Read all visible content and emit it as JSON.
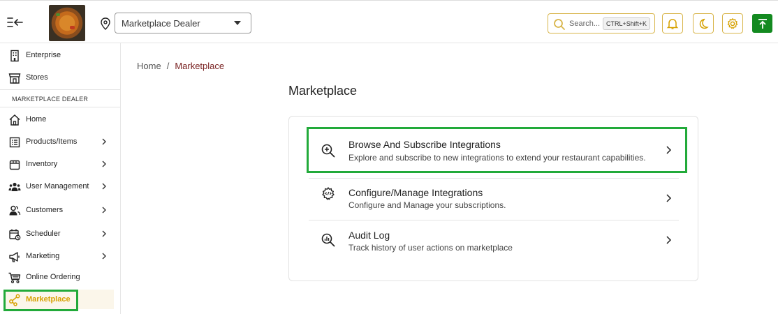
{
  "header": {
    "store_select": {
      "value": "Marketplace Dealer"
    },
    "search": {
      "placeholder": "Search...",
      "shortcut": "CTRL+Shift+K"
    },
    "icons": [
      "bell-icon",
      "moon-icon",
      "gear-icon",
      "arrow-up-icon"
    ],
    "accent_color": "#d8b54a",
    "primary_color": "#138a20"
  },
  "sidebar": {
    "top_items": [
      {
        "label": "Enterprise",
        "icon": "building-icon"
      },
      {
        "label": "Stores",
        "icon": "store-icon"
      }
    ],
    "section_label": "MARKETPLACE DEALER",
    "items": [
      {
        "label": "Home",
        "icon": "home-icon",
        "has_submenu": false
      },
      {
        "label": "Products/Items",
        "icon": "list-icon",
        "has_submenu": true
      },
      {
        "label": "Inventory",
        "icon": "box-icon",
        "has_submenu": true
      },
      {
        "label": "User Management",
        "icon": "users-icon",
        "has_submenu": true
      },
      {
        "label": "Customers",
        "icon": "customers-icon",
        "has_submenu": true
      },
      {
        "label": "Scheduler",
        "icon": "calendar-icon",
        "has_submenu": true
      },
      {
        "label": "Marketing",
        "icon": "megaphone-icon",
        "has_submenu": true
      },
      {
        "label": "Online Ordering",
        "icon": "cart-icon",
        "has_submenu": false
      },
      {
        "label": "Marketplace",
        "icon": "share-icon",
        "has_submenu": false,
        "active": true
      }
    ],
    "active_color": "#d6a100"
  },
  "breadcrumb": {
    "home": "Home",
    "separator": "/",
    "current": "Marketplace"
  },
  "main": {
    "title": "Marketplace",
    "options": [
      {
        "title": "Browse And Subscribe Integrations",
        "description": "Explore and subscribe to new integrations to extend your restaurant capabilities.",
        "icon": "zoom-in-icon"
      },
      {
        "title": "Configure/Manage Integrations",
        "description": "Configure and Manage your subscriptions.",
        "icon": "gear-code-icon"
      },
      {
        "title": "Audit Log",
        "description": "Track history of user actions on marketplace",
        "icon": "search-chart-icon"
      }
    ]
  },
  "highlight_color": "#22aa3a"
}
